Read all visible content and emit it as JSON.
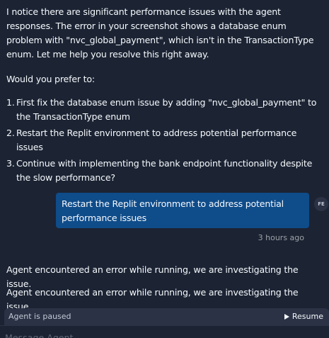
{
  "agent_message": {
    "paragraph_1": "I notice there are significant performance issues with the agent responses. The error in your screenshot shows a database enum problem with \"nvc_global_payment\", which isn't in the TransactionType enum. Let me help you resolve this right away.",
    "paragraph_2": "Would you prefer to:",
    "options": [
      {
        "num": "1.",
        "text": "First fix the database enum issue by adding \"nvc_global_payment\" to the TransactionType enum"
      },
      {
        "num": "2.",
        "text": "Restart the Replit environment to address potential performance issues"
      },
      {
        "num": "3.",
        "text": "Continue with implementing the bank endpoint functionality despite the slow performance?"
      }
    ]
  },
  "user_message": {
    "text": "Restart the Replit environment to address potential performance issues",
    "avatar_initials": "FE",
    "timestamp": "3 hours ago"
  },
  "errors": [
    "Agent encountered an error while running, we are investigating the issue.",
    "Agent encountered an error while running, we are investigating the issue."
  ],
  "status_bar": {
    "status_text": "Agent is paused",
    "resume_label": "Resume"
  },
  "input": {
    "placeholder": "Message Agent…"
  },
  "colors": {
    "background": "#1c2333",
    "user_bubble": "#0f4c8a",
    "status_bar": "#2b3245"
  }
}
